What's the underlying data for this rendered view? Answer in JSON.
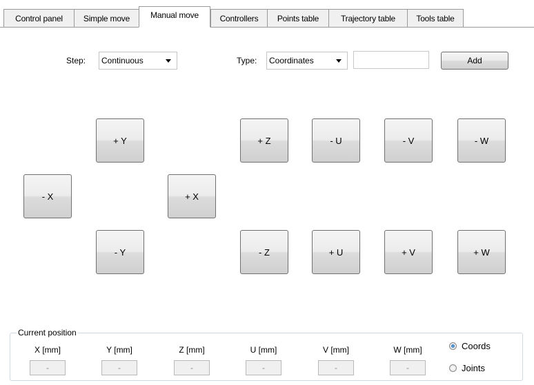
{
  "tabs": [
    {
      "label": "Control panel"
    },
    {
      "label": "Simple move"
    },
    {
      "label": "Manual move",
      "active": true
    },
    {
      "label": "Controllers"
    },
    {
      "label": "Points table"
    },
    {
      "label": "Trajectory table"
    },
    {
      "label": "Tools table"
    }
  ],
  "toolbar": {
    "step_label": "Step:",
    "step_value": "Continuous",
    "type_label": "Type:",
    "type_value": "Coordinates",
    "name_value": "",
    "add_label": "Add"
  },
  "jog": {
    "plus_y": "+ Y",
    "minus_x": "- X",
    "plus_x": "+ X",
    "minus_y": "- Y",
    "plus_z": "+ Z",
    "minus_z": "- Z",
    "minus_u": "- U",
    "plus_u": "+ U",
    "minus_v": "- V",
    "plus_v": "+ V",
    "minus_w": "- W",
    "plus_w": "+ W"
  },
  "position": {
    "title": "Current position",
    "axes": [
      {
        "label": "X [mm]",
        "value": "-"
      },
      {
        "label": "Y [mm]",
        "value": "-"
      },
      {
        "label": "Z [mm]",
        "value": "-"
      },
      {
        "label": "U [mm]",
        "value": "-"
      },
      {
        "label": "V [mm]",
        "value": "-"
      },
      {
        "label": "W [mm]",
        "value": "-"
      }
    ],
    "mode_coords": "Coords",
    "mode_joints": "Joints",
    "selected_mode": "Coords"
  }
}
